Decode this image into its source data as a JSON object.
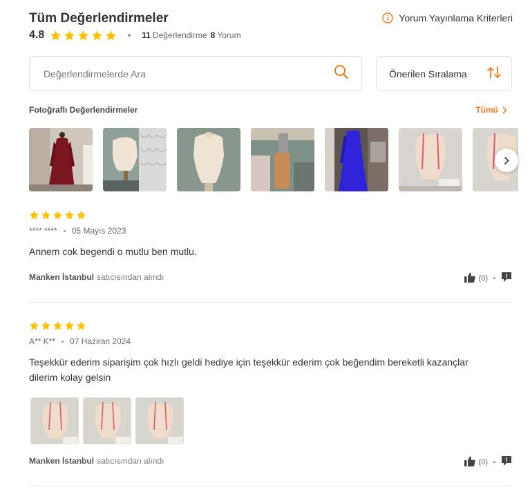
{
  "header": {
    "title": "Tüm Değerlendirmeler",
    "criteria_label": "Yorum Yayınlama Kriterleri",
    "criteria_icon": "info-icon"
  },
  "summary": {
    "score": "4.8",
    "stars": 5,
    "rating_count": "11",
    "rating_label": "Değerlendirme",
    "comment_count": "8",
    "comment_label": "Yorum"
  },
  "search": {
    "placeholder": "Değerlendirmelerde Ara",
    "icon": "search-icon"
  },
  "sort": {
    "label": "Önerilen Sıralama",
    "icon": "sort-icon"
  },
  "photos": {
    "title": "Fotoğraflı Değerlendirmeler",
    "see_all": "Tümü",
    "items": [
      "photo-red-dress",
      "photo-mannequin-1",
      "photo-mannequin-2",
      "photo-mannequin-3",
      "photo-blue-dress",
      "photo-mannequin-4",
      "photo-mannequin-5"
    ]
  },
  "reviews": [
    {
      "stars": 5,
      "author": "**** ****",
      "date": "05 Mayıs 2023",
      "text": "Annem cok begendi o mutlu ben mutlu.",
      "seller": "Manken İstanbul",
      "seller_suffix": "satıcısından alındı",
      "likes": "(0)"
    },
    {
      "stars": 5,
      "author": "A** K**",
      "date": "07 Haziran 2024",
      "text": "Teşekkür ederim siparişim çok hızlı geldi hediye için teşekkür ederim çok beğendim bereketli kazançlar dilerim kolay gelsin",
      "seller": "Manken İstanbul",
      "seller_suffix": "satıcısından alındı",
      "likes": "(0)"
    }
  ],
  "colors": {
    "accent": "#f27a1a",
    "star": "#ffc000",
    "text": "#333333"
  }
}
